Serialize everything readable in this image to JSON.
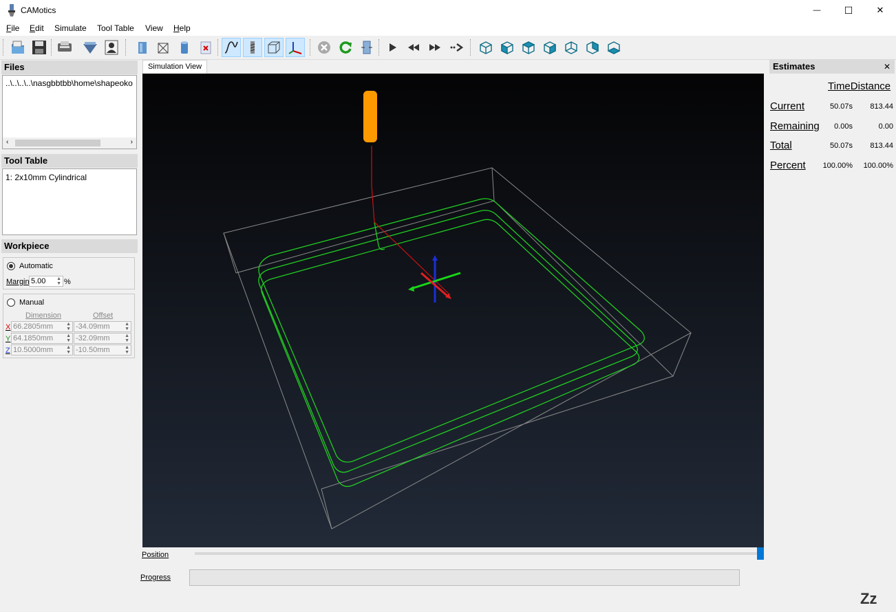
{
  "window": {
    "title": "CAMotics",
    "minimize_glyph": "—",
    "maximize_glyph": "☐",
    "close_glyph": "✕"
  },
  "menu": [
    {
      "label_u": "F",
      "label_rest": "ile"
    },
    {
      "label_u": "E",
      "label_rest": "dit"
    },
    {
      "label_u": "",
      "label_rest": "Simulate"
    },
    {
      "label_u": "",
      "label_rest": "Tool Table"
    },
    {
      "label_u": "",
      "label_rest": "View"
    },
    {
      "label_u": "H",
      "label_rest": "elp"
    }
  ],
  "toolbar": {
    "icons": [
      "open-file-icon",
      "save-file-icon",
      "export-icon",
      "import-tool-icon",
      "user-icon",
      "show-workpiece-icon",
      "wireframe-icon",
      "show-tool-icon",
      "hide-surface-icon",
      "show-path-icon",
      "show-tool-bit-icon",
      "show-bbox-icon",
      "show-axes-icon",
      "stop-icon",
      "rerun-icon",
      "export-gcode-icon",
      "play-icon",
      "rewind-icon",
      "fast-forward-icon",
      "step-icon",
      "view-iso-icon",
      "view-front-icon",
      "view-top-icon",
      "view-right-icon",
      "view-back-icon",
      "view-left-icon",
      "view-bottom-icon"
    ]
  },
  "files": {
    "title": "Files",
    "items": [
      "..\\..\\..\\..\\nasgbbtbb\\home\\shapeoko"
    ]
  },
  "tool_table": {
    "title": "Tool Table",
    "items": [
      "1: 2x10mm Cylindrical"
    ]
  },
  "workpiece": {
    "title": "Workpiece",
    "automatic_label": "Automatic",
    "margin_label": "Margin",
    "margin_value": "5.00",
    "margin_unit": "%",
    "manual_label": "Manual",
    "dimension_header": "Dimension",
    "offset_header": "Offset",
    "rows": [
      {
        "axis": "X",
        "dimension": "66.2805mm",
        "offset": "-34.09mm",
        "color": "#d40000"
      },
      {
        "axis": "Y",
        "dimension": "64.1850mm",
        "offset": "-32.09mm",
        "color": "#2a8a2a"
      },
      {
        "axis": "Z",
        "dimension": "10.5000mm",
        "offset": "-10.50mm",
        "color": "#2040c0"
      }
    ]
  },
  "simulation": {
    "tab_label": "Simulation View",
    "position_label": "Position",
    "progress_label": "Progress",
    "position_fraction": 1.0
  },
  "estimates": {
    "title": "Estimates",
    "close_glyph": "✕",
    "header": "TimeDistance",
    "rows": [
      {
        "label": "Current",
        "time": "50.07s",
        "distance": "813.44"
      },
      {
        "label": "Remaining",
        "time": "0.00s",
        "distance": "0.00"
      },
      {
        "label": "Total",
        "time": "50.07s",
        "distance": "813.44"
      },
      {
        "label": "Percent",
        "time": "100.00%",
        "distance": "100.00%"
      }
    ]
  },
  "status": {
    "sleep_text": "Zz"
  },
  "colors": {
    "toolpath": "#22cc22",
    "tool": "#ff9900",
    "bbox": "#8a8a8a",
    "selection": "#0078d7"
  }
}
